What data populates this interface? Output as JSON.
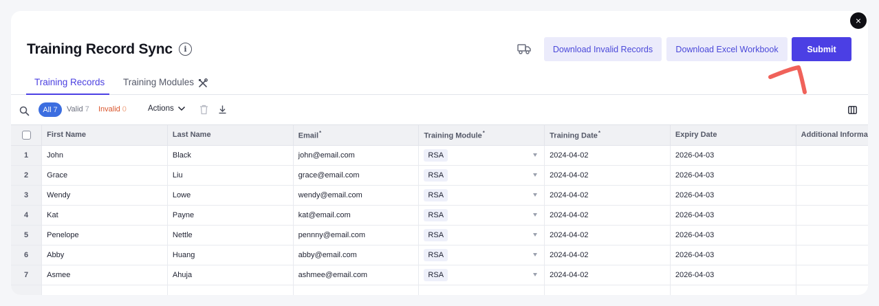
{
  "header": {
    "title": "Training Record Sync",
    "close_label": "×",
    "buttons": {
      "download_invalid": "Download Invalid Records",
      "download_workbook": "Download Excel Workbook",
      "submit": "Submit"
    }
  },
  "tabs": [
    {
      "label": "Training Records",
      "active": true
    },
    {
      "label": "Training Modules",
      "active": false
    }
  ],
  "toolbar": {
    "filters": {
      "all": {
        "label": "All",
        "count": "7"
      },
      "valid": {
        "label": "Valid",
        "count": "7"
      },
      "invalid": {
        "label": "Invalid",
        "count": "0"
      }
    },
    "actions_label": "Actions"
  },
  "table": {
    "columns": [
      {
        "label": "First Name",
        "required": false
      },
      {
        "label": "Last Name",
        "required": false
      },
      {
        "label": "Email",
        "required": true
      },
      {
        "label": "Training Module",
        "required": true
      },
      {
        "label": "Training Date",
        "required": true
      },
      {
        "label": "Expiry Date",
        "required": false
      },
      {
        "label": "Additional Information",
        "required": false
      }
    ],
    "required_marker": "*",
    "rows": [
      {
        "n": "1",
        "first": "John",
        "last": "Black",
        "email": "john@email.com",
        "module": "RSA",
        "training_date": "2024-04-02",
        "expiry_date": "2026-04-03",
        "info": ""
      },
      {
        "n": "2",
        "first": "Grace",
        "last": "Liu",
        "email": "grace@email.com",
        "module": "RSA",
        "training_date": "2024-04-02",
        "expiry_date": "2026-04-03",
        "info": ""
      },
      {
        "n": "3",
        "first": "Wendy",
        "last": "Lowe",
        "email": "wendy@email.com",
        "module": "RSA",
        "training_date": "2024-04-02",
        "expiry_date": "2026-04-03",
        "info": ""
      },
      {
        "n": "4",
        "first": "Kat",
        "last": "Payne",
        "email": "kat@email.com",
        "module": "RSA",
        "training_date": "2024-04-02",
        "expiry_date": "2026-04-03",
        "info": ""
      },
      {
        "n": "5",
        "first": "Penelope",
        "last": "Nettle",
        "email": "pennny@email.com",
        "module": "RSA",
        "training_date": "2024-04-02",
        "expiry_date": "2026-04-03",
        "info": ""
      },
      {
        "n": "6",
        "first": "Abby",
        "last": "Huang",
        "email": "abby@email.com",
        "module": "RSA",
        "training_date": "2024-04-02",
        "expiry_date": "2026-04-03",
        "info": ""
      },
      {
        "n": "7",
        "first": "Asmee",
        "last": "Ahuja",
        "email": "ashmee@email.com",
        "module": "RSA",
        "training_date": "2024-04-02",
        "expiry_date": "2026-04-03",
        "info": ""
      }
    ]
  },
  "icons": {
    "info": "info-icon",
    "truck": "truck-icon",
    "tools": "tools-icon",
    "search": "search-icon",
    "chevron": "chevron-down-icon",
    "trash": "trash-icon",
    "download": "download-icon",
    "columns": "columns-icon",
    "close": "close-icon"
  },
  "colors": {
    "primary": "#4b3fe4",
    "light_button": "#ebebfb",
    "pill_all": "#3c6ee0",
    "invalid": "#d9552c",
    "annotation": "#f0625a"
  }
}
